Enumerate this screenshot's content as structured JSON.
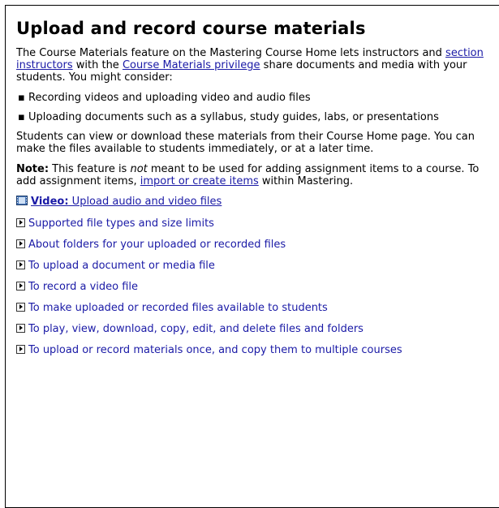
{
  "page": {
    "title": "Upload and record course materials",
    "intro": {
      "before_link1": "The Course Materials feature on the Mastering Course Home lets instructors and ",
      "link1": "section instructors",
      "between": " with the ",
      "link2": "Course Materials privilege",
      "after": " share documents and media with your students. You might consider:"
    },
    "bullets": [
      "Recording videos and uploading video and audio files",
      "Uploading documents such as a syllabus, study guides, labs, or presentations"
    ],
    "students_paragraph": "Students can view or download these materials from their Course Home page. You can make the files available to students immediately, or at a later time.",
    "note": {
      "label": "Note:",
      "text_before_italic": " This feature is ",
      "italic": "not",
      "text_after_italic": " meant to be used for adding assignment items to a course. To add assignment items, ",
      "link": "import or create items",
      "text_end": " within Mastering."
    },
    "video_link": {
      "label": "Video:",
      "text": " Upload audio and video files",
      "icon": "film-icon"
    },
    "expand_links": [
      "Supported file types and size limits",
      "About folders for your uploaded or recorded files",
      "To upload a document or media file",
      "To record a video file",
      "To make uploaded or recorded files available to students",
      "To play, view, download, copy, edit, and delete files and folders",
      "To upload or record materials once, and copy them to multiple courses"
    ]
  }
}
